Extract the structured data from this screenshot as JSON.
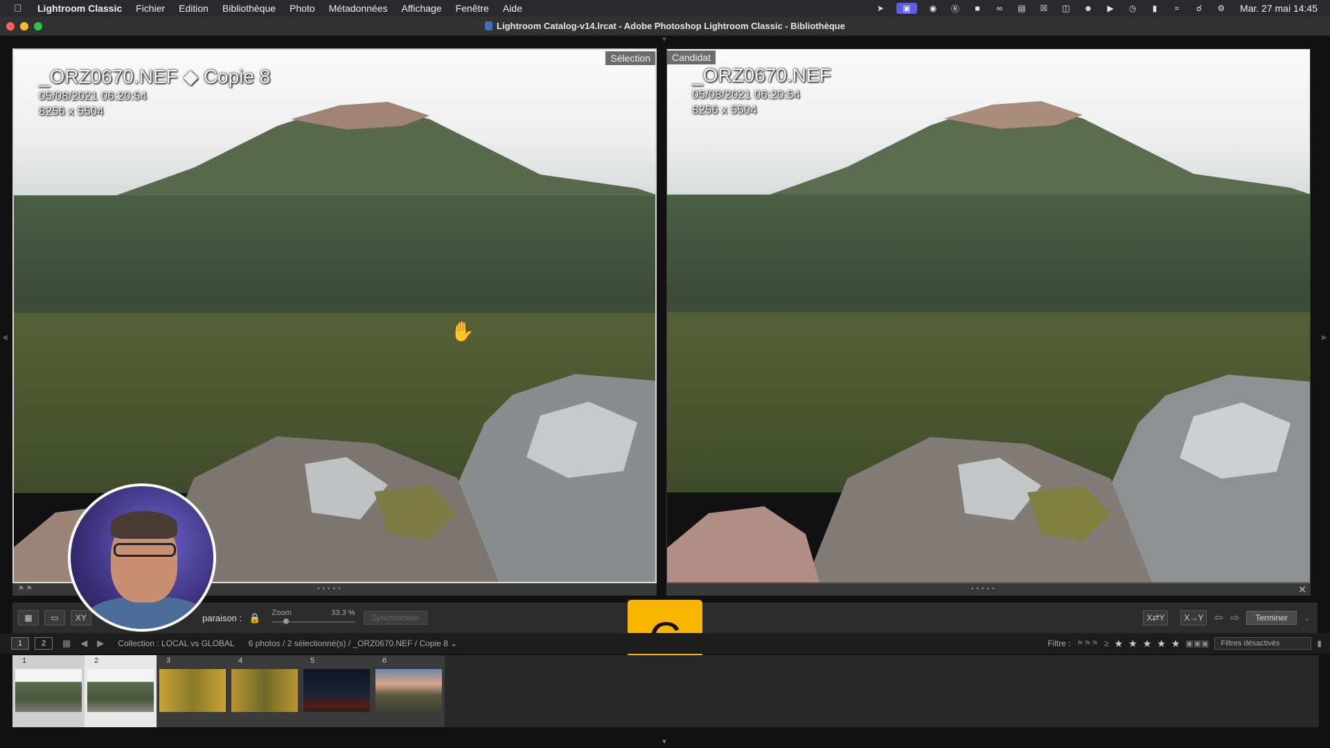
{
  "menubar": {
    "app_name": "Lightroom Classic",
    "items": [
      "Fichier",
      "Edition",
      "Bibliothèque",
      "Photo",
      "Métadonnées",
      "Affichage",
      "Fenêtre",
      "Aide"
    ],
    "clock": "Mar. 27 mai  14:45"
  },
  "window": {
    "title": "Lightroom Catalog-v14.lrcat - Adobe Photoshop Lightroom Classic - Bibliothèque"
  },
  "compare": {
    "left": {
      "label": "Sélection",
      "filename": "_ORZ0670.NEF  ◆  Copie 8",
      "datetime": "05/08/2021 06:20:54",
      "dimensions": "8256 x 5504"
    },
    "right": {
      "label": "Candidat",
      "filename": "_ORZ0670.NEF",
      "datetime": "05/08/2021 06:20:54",
      "dimensions": "8256 x 5504"
    }
  },
  "toolbar": {
    "compare_label": "paraison :",
    "zoom_label": "Zoom",
    "zoom_value": "33.3 %",
    "sync_label": "Synchroniser",
    "done_label": "Terminer"
  },
  "key_badge": "C",
  "filmbar": {
    "screen1": "1",
    "screen2": "2",
    "collection": "Collection : LOCAL vs GLOBAL",
    "selection_info": "6 photos / 2 sélectionné(s) / _ORZ0670.NEF / Copie 8 ⌄",
    "filter_label": "Filtre :",
    "filter_select": "Filtres désactivés"
  },
  "thumbnails": [
    {
      "num": "1"
    },
    {
      "num": "2"
    },
    {
      "num": "3"
    },
    {
      "num": "4"
    },
    {
      "num": "5"
    },
    {
      "num": "6"
    }
  ]
}
